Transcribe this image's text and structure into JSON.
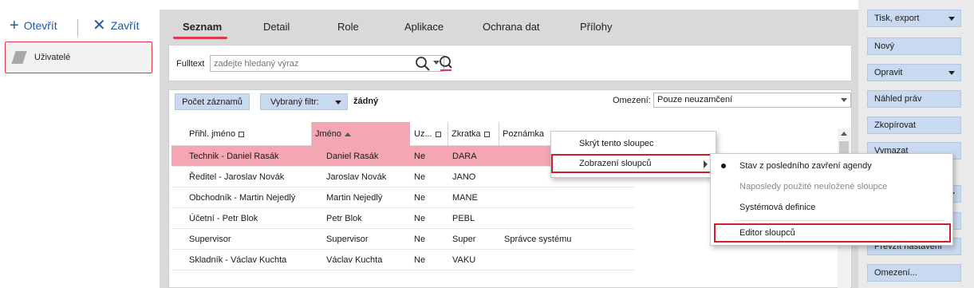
{
  "toolbar": {
    "open_label": "Otevřít",
    "close_label": "Zavřít"
  },
  "nav": {
    "item_label": "Uživatelé"
  },
  "tabs": [
    {
      "label": "Seznam"
    },
    {
      "label": "Detail"
    },
    {
      "label": "Role"
    },
    {
      "label": "Aplikace"
    },
    {
      "label": "Ochrana dat"
    },
    {
      "label": "Přílohy"
    }
  ],
  "search": {
    "label": "Fulltext",
    "placeholder": "zadejte hledaný výraz"
  },
  "grid_toolbar": {
    "count_label": "Počet záznamů",
    "filter_label": "Vybraný filtr:",
    "filter_value": "žádný",
    "restriction_label": "Omezení:",
    "restriction_value": "Pouze neuzamčení"
  },
  "table": {
    "columns": [
      "Přihl. jméno",
      "Jméno",
      "Uz...",
      "Zkratka",
      "Poznámka"
    ],
    "rows": [
      [
        "Technik - Daniel Rasák",
        "Daniel Rasák",
        "Ne",
        "DARA",
        ""
      ],
      [
        "Ředitel - Jaroslav Novák",
        "Jaroslav Novák",
        "Ne",
        "JANO",
        ""
      ],
      [
        "Obchodník - Martin Nejedlý",
        "Martin Nejedlý",
        "Ne",
        "MANE",
        ""
      ],
      [
        "Účetní - Petr Blok",
        "Petr Blok",
        "Ne",
        "PEBL",
        ""
      ],
      [
        "Supervisor",
        "Supervisor",
        "Ne",
        "Super",
        "Správce systému"
      ],
      [
        "Skladník - Václav Kuchta",
        "Václav Kuchta",
        "Ne",
        "VAKU",
        ""
      ]
    ]
  },
  "right_panel": {
    "buttons": [
      "Tisk, export",
      "Nový",
      "Opravit",
      "Náhled práv",
      "Zkopírovat",
      "Vymazat",
      "",
      "",
      "Převzít nastavení",
      "Omezení..."
    ]
  },
  "context_menu": {
    "items": [
      "Skrýt tento sloupec",
      "Zobrazení sloupců"
    ]
  },
  "submenu": {
    "items": [
      "Stav z posledního zavření agendy",
      "Naposledy použité neuložené sloupce",
      "Systémová definice",
      "Editor sloupců"
    ]
  },
  "colors": {
    "accent": "#e0394b",
    "selection": "#f4a6b2",
    "button_bg": "#c9daf0",
    "link": "#1e5aa8"
  }
}
